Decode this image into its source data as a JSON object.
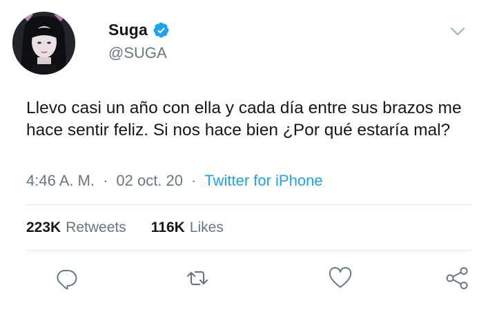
{
  "user": {
    "display_name": "Suga",
    "handle": "@SUGA",
    "verified_icon": "verified-badge-icon",
    "avatar_icon": "avatar-photo"
  },
  "tweet": {
    "text": "Llevo casi un año con ella y cada día entre sus brazos me hace sentir feliz. Si nos hace bien ¿Por qué estaría mal?",
    "time": "4:46 A. M.",
    "date": "02 oct. 20",
    "separator": "·",
    "source": "Twitter for iPhone"
  },
  "stats": {
    "retweets_count": "223K",
    "retweets_label": "Retweets",
    "likes_count": "116K",
    "likes_label": "Likes"
  },
  "actions": [
    "reply-icon",
    "retweet-icon",
    "like-icon",
    "share-icon"
  ],
  "colors": {
    "accent": "#1da1f2",
    "secondary_text": "#657786",
    "primary_text": "#14171a",
    "divider": "#e1e8ed"
  }
}
